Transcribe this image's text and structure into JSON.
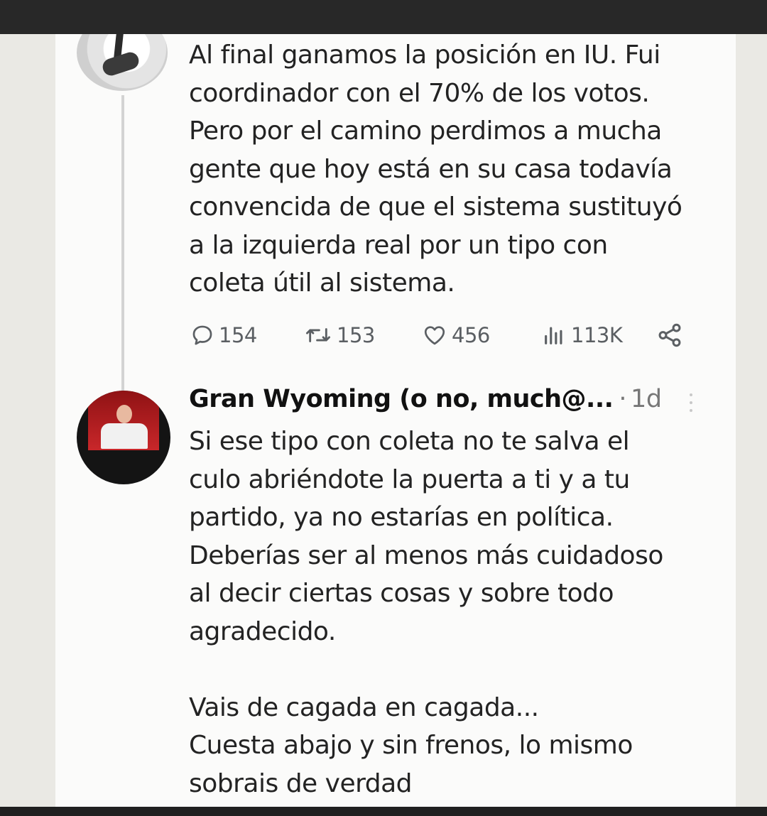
{
  "tweet1": {
    "text": "Al final ganamos la posición en IU. Fui\ncoordinador con el 70% de los votos.\nPero por el camino perdimos a mucha\ngente que hoy está en su casa todavía\nconvencida de que el sistema sustituyó\na la izquierda real por un tipo con\ncoleta útil al sistema.",
    "replies": "154",
    "retweets": "153",
    "likes": "456",
    "views": "113K"
  },
  "tweet2": {
    "author": "Gran Wyoming (o no, much@...",
    "separator": "·",
    "time": "1d",
    "text": "Si ese tipo con coleta no te salva el\nculo abriéndote la puerta a ti y a tu\npartido, ya no estarías en política.\nDeberías ser al menos más cuidadoso\nal decir ciertas cosas y sobre todo\nagradecido.\n\nVais de cagada en cagada...\nCuesta abajo y sin frenos, lo mismo\nsobrais de verdad"
  },
  "icons": {
    "reply": "reply-icon",
    "retweet": "retweet-icon",
    "like": "heart-icon",
    "views": "views-icon",
    "share": "share-icon",
    "more": "more-icon"
  },
  "colors": {
    "card": "#fbfbfa",
    "text": "#232323",
    "muted": "#5b5f63",
    "frame": "#282828"
  }
}
